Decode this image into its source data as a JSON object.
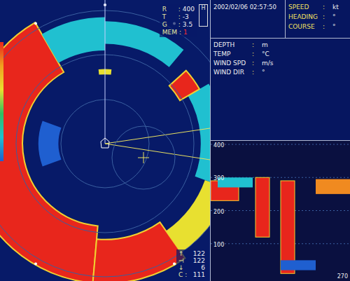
{
  "sonar": {
    "readouts": [
      {
        "label": "R",
        "sep": ":",
        "value": "400",
        "alert": false
      },
      {
        "label": "T",
        "sep": ":",
        "value": "-3",
        "alert": false
      },
      {
        "label": "G",
        "sep": ":",
        "value": "3.5",
        "alert": false
      },
      {
        "label": "MEM",
        "sep": ":",
        "value": "1",
        "alert": true
      }
    ],
    "heading_box": "H",
    "echoes": [
      {
        "start_deg": 185,
        "end_deg": 330,
        "inner": 0.62,
        "outer": 1.05,
        "level": 0.95
      },
      {
        "start_deg": 145,
        "end_deg": 185,
        "inner": 0.72,
        "outer": 1.05,
        "level": 0.9
      },
      {
        "start_deg": 110,
        "end_deg": 145,
        "inner": 0.8,
        "outer": 1.0,
        "level": 0.5
      },
      {
        "start_deg": 60,
        "end_deg": 110,
        "inner": 0.72,
        "outer": 0.9,
        "level": 0.35
      },
      {
        "start_deg": 330,
        "end_deg": 360,
        "inner": 0.7,
        "outer": 0.95,
        "level": 0.45
      },
      {
        "start_deg": 0,
        "end_deg": 40,
        "inner": 0.75,
        "outer": 0.92,
        "level": 0.4
      },
      {
        "start_deg": 48,
        "end_deg": 60,
        "inner": 0.65,
        "outer": 0.82,
        "level": 0.95
      },
      {
        "start_deg": 355,
        "end_deg": 5,
        "inner": 0.52,
        "outer": 0.56,
        "level": 0.6
      },
      {
        "start_deg": 250,
        "end_deg": 290,
        "inner": 0.35,
        "outer": 0.5,
        "level": 0.3
      }
    ],
    "bottom_readouts": [
      {
        "symbol": "↑",
        "value": "122"
      },
      {
        "symbol": "⊣",
        "value": "122"
      },
      {
        "symbol": "↓",
        "value": "6"
      },
      {
        "symbol": "C :",
        "value": "111"
      }
    ]
  },
  "info": {
    "datetime": "2002/02/06 02:57:50",
    "nav": [
      {
        "label": "SPEED",
        "sep": ":",
        "unit": "kt"
      },
      {
        "label": "HEADING",
        "sep": ":",
        "unit": "°"
      },
      {
        "label": "COURSE",
        "sep": ":",
        "unit": "°"
      }
    ],
    "env": [
      {
        "label": "DEPTH",
        "sep": ":",
        "unit": "m"
      },
      {
        "label": "TEMP",
        "sep": ":",
        "unit": "°C"
      },
      {
        "label": "WIND SPD",
        "sep": ":",
        "unit": "m/s"
      },
      {
        "label": "WIND DIR",
        "sep": ":",
        "unit": "°"
      }
    ]
  },
  "echogram": {
    "ticks": [
      "400",
      "300",
      "200",
      "100"
    ],
    "corner": "270",
    "echoes": [
      {
        "x0": 0.0,
        "x1": 0.2,
        "v0": 230,
        "v1": 290,
        "level": 0.9
      },
      {
        "x0": 0.05,
        "x1": 0.3,
        "v0": 270,
        "v1": 300,
        "level": 0.4
      },
      {
        "x0": 0.32,
        "x1": 0.42,
        "v0": 120,
        "v1": 300,
        "level": 0.9
      },
      {
        "x0": 0.5,
        "x1": 0.6,
        "v0": 10,
        "v1": 290,
        "level": 0.95
      },
      {
        "x0": 0.75,
        "x1": 1.0,
        "v0": 250,
        "v1": 295,
        "level": 0.8
      },
      {
        "x0": 0.5,
        "x1": 0.75,
        "v0": 20,
        "v1": 50,
        "level": 0.3
      }
    ]
  }
}
